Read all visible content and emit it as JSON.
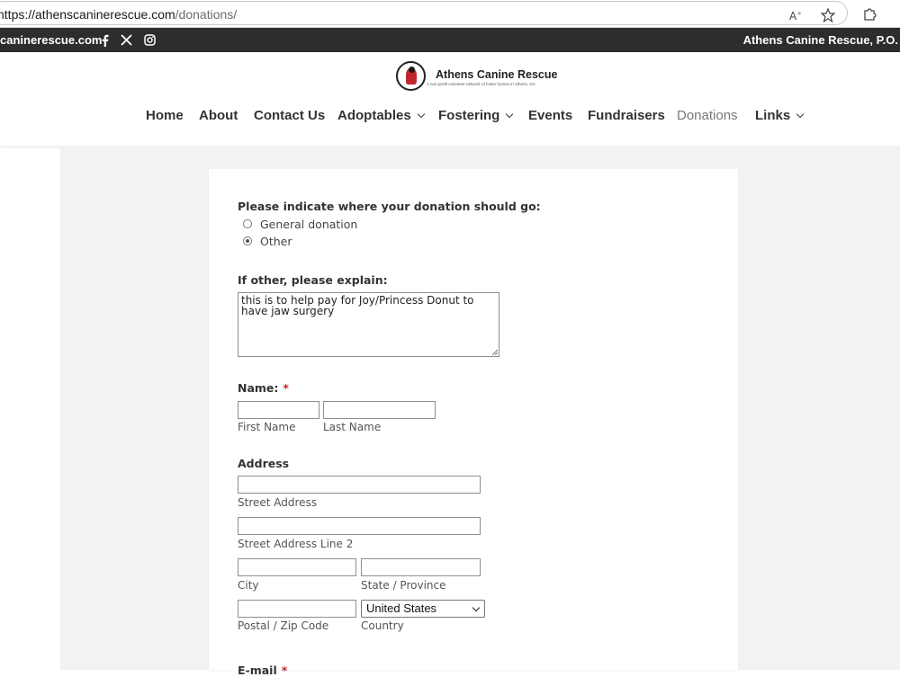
{
  "browser": {
    "url_host": "https://athenscaninerescue.com",
    "url_path": "/donations/",
    "icons": [
      "read-aloud-icon",
      "favorite-star-icon",
      "extensions-icon"
    ]
  },
  "topstrip": {
    "site_text": "caninerescue.com",
    "right_text": "Athens Canine Rescue, P.O.",
    "social": [
      "facebook-icon",
      "x-icon",
      "instagram-icon"
    ]
  },
  "logo": {
    "title": "Athens Canine Rescue",
    "tagline": "A non-profit volunteer network of foster homes in Athens, GA"
  },
  "nav": {
    "items": [
      {
        "label": "Home"
      },
      {
        "label": "About"
      },
      {
        "label": "Contact Us"
      },
      {
        "label": "Adoptables"
      },
      {
        "label": "Fostering"
      },
      {
        "label": "Events"
      },
      {
        "label": "Fundraisers"
      },
      {
        "label": "Donations"
      },
      {
        "label": "Links"
      }
    ],
    "active": "Donations"
  },
  "form": {
    "destination_label": "Please indicate where your donation should go:",
    "options": [
      {
        "label": "General donation",
        "checked": false
      },
      {
        "label": "Other",
        "checked": true
      }
    ],
    "explain_label": "If other, please explain:",
    "explain_value": "this is to help pay for Joy/Princess Donut to have jaw surgery",
    "name_label": "Name:",
    "required_mark": "*",
    "first_name_label": "First Name",
    "last_name_label": "Last Name",
    "address_label": "Address",
    "street_label": "Street Address",
    "street2_label": "Street Address Line 2",
    "city_label": "City",
    "state_label": "State / Province",
    "zip_label": "Postal / Zip Code",
    "country_label": "Country",
    "country_value": "United States",
    "email_label": "E-mail"
  }
}
